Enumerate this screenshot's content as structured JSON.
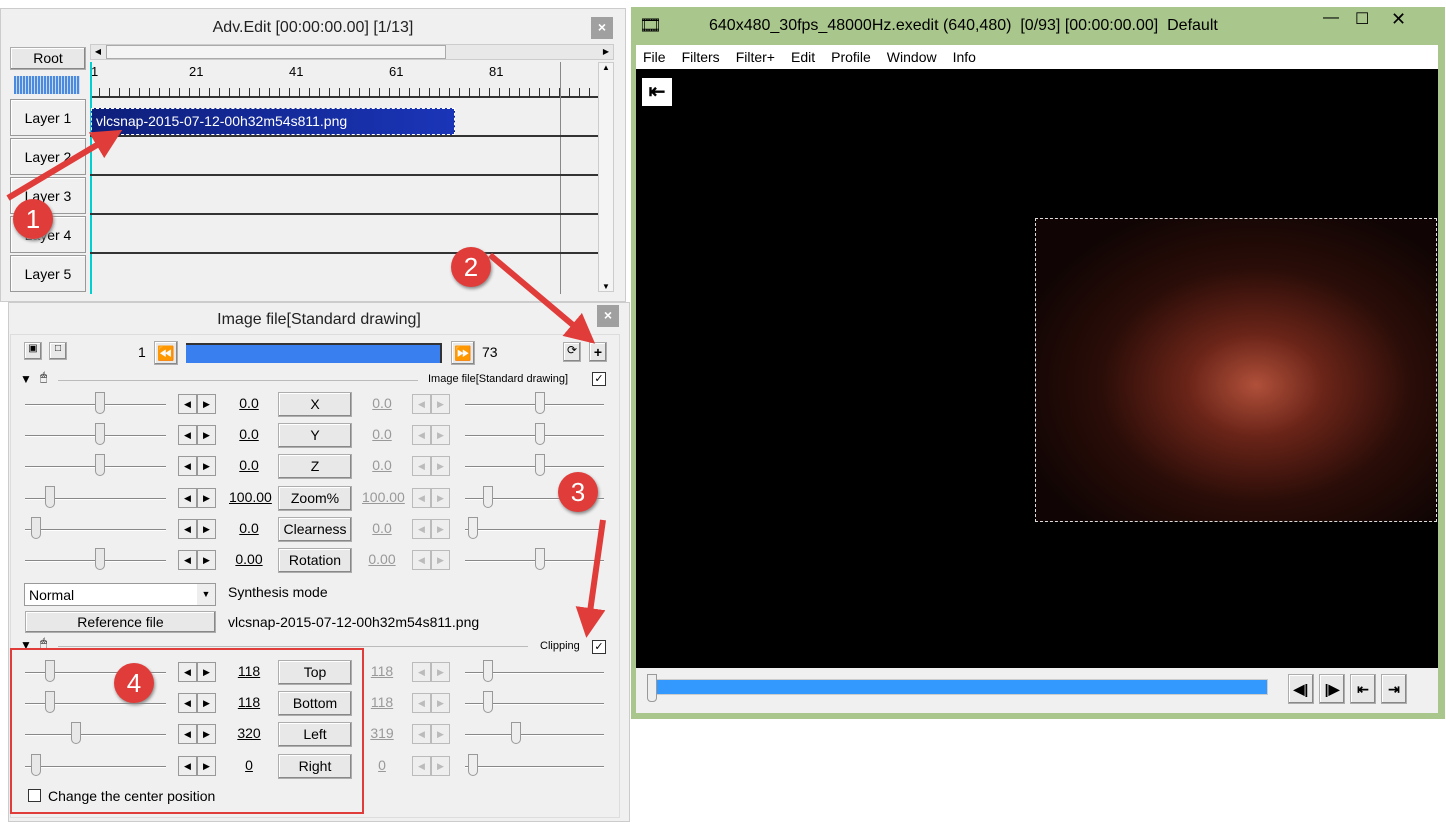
{
  "advedit": {
    "title": "Adv.Edit [00:00:00.00] [1/13]",
    "close": "×",
    "root": "Root",
    "ruler": [
      "1",
      "21",
      "41",
      "61",
      "81"
    ],
    "layers": [
      "Layer 1",
      "Layer 2",
      "Layer 3",
      "Layer 4",
      "Layer 5"
    ],
    "clip": "vlcsnap-2015-07-12-00h32m54s811.png"
  },
  "props": {
    "title": "Image file[Standard drawing]",
    "close": "×",
    "start_frame": "1",
    "end_frame": "73",
    "section_label": "Image file[Standard drawing]",
    "section_checked": true,
    "params": [
      {
        "name": "X",
        "left": "0.0",
        "right": "0.0"
      },
      {
        "name": "Y",
        "left": "0.0",
        "right": "0.0"
      },
      {
        "name": "Z",
        "left": "0.0",
        "right": "0.0"
      },
      {
        "name": "Zoom%",
        "left": "100.00",
        "right": "100.00"
      },
      {
        "name": "Clearness",
        "left": "0.0",
        "right": "0.0"
      },
      {
        "name": "Rotation",
        "left": "0.00",
        "right": "0.00"
      }
    ],
    "synthesis_value": "Normal",
    "synthesis_label": "Synthesis mode",
    "reference_button": "Reference file",
    "reference_value": "vlcsnap-2015-07-12-00h32m54s811.png",
    "clipping_label": "Clipping",
    "clipping_checked": true,
    "clipping": [
      {
        "name": "Top",
        "left": "118",
        "right": "118"
      },
      {
        "name": "Bottom",
        "left": "118",
        "right": "118"
      },
      {
        "name": "Left",
        "left": "320",
        "right": "319"
      },
      {
        "name": "Right",
        "left": "0",
        "right": "0"
      }
    ],
    "center_label": "Change the center position",
    "center_checked": false
  },
  "preview": {
    "title": "640x480_30fps_48000Hz.exedit (640,480)  [0/93] [00:00:00.00]  Default",
    "menu": [
      "File",
      "Filters",
      "Filter+",
      "Edit",
      "Profile",
      "Window",
      "Info"
    ],
    "border_color": "#a9c68d"
  },
  "annotations": [
    "1",
    "2",
    "3",
    "4"
  ],
  "colors": {
    "accent_blue": "#3399ff",
    "annotation_red": "#e03c3a",
    "clip_blue": "#1a2fa0"
  }
}
